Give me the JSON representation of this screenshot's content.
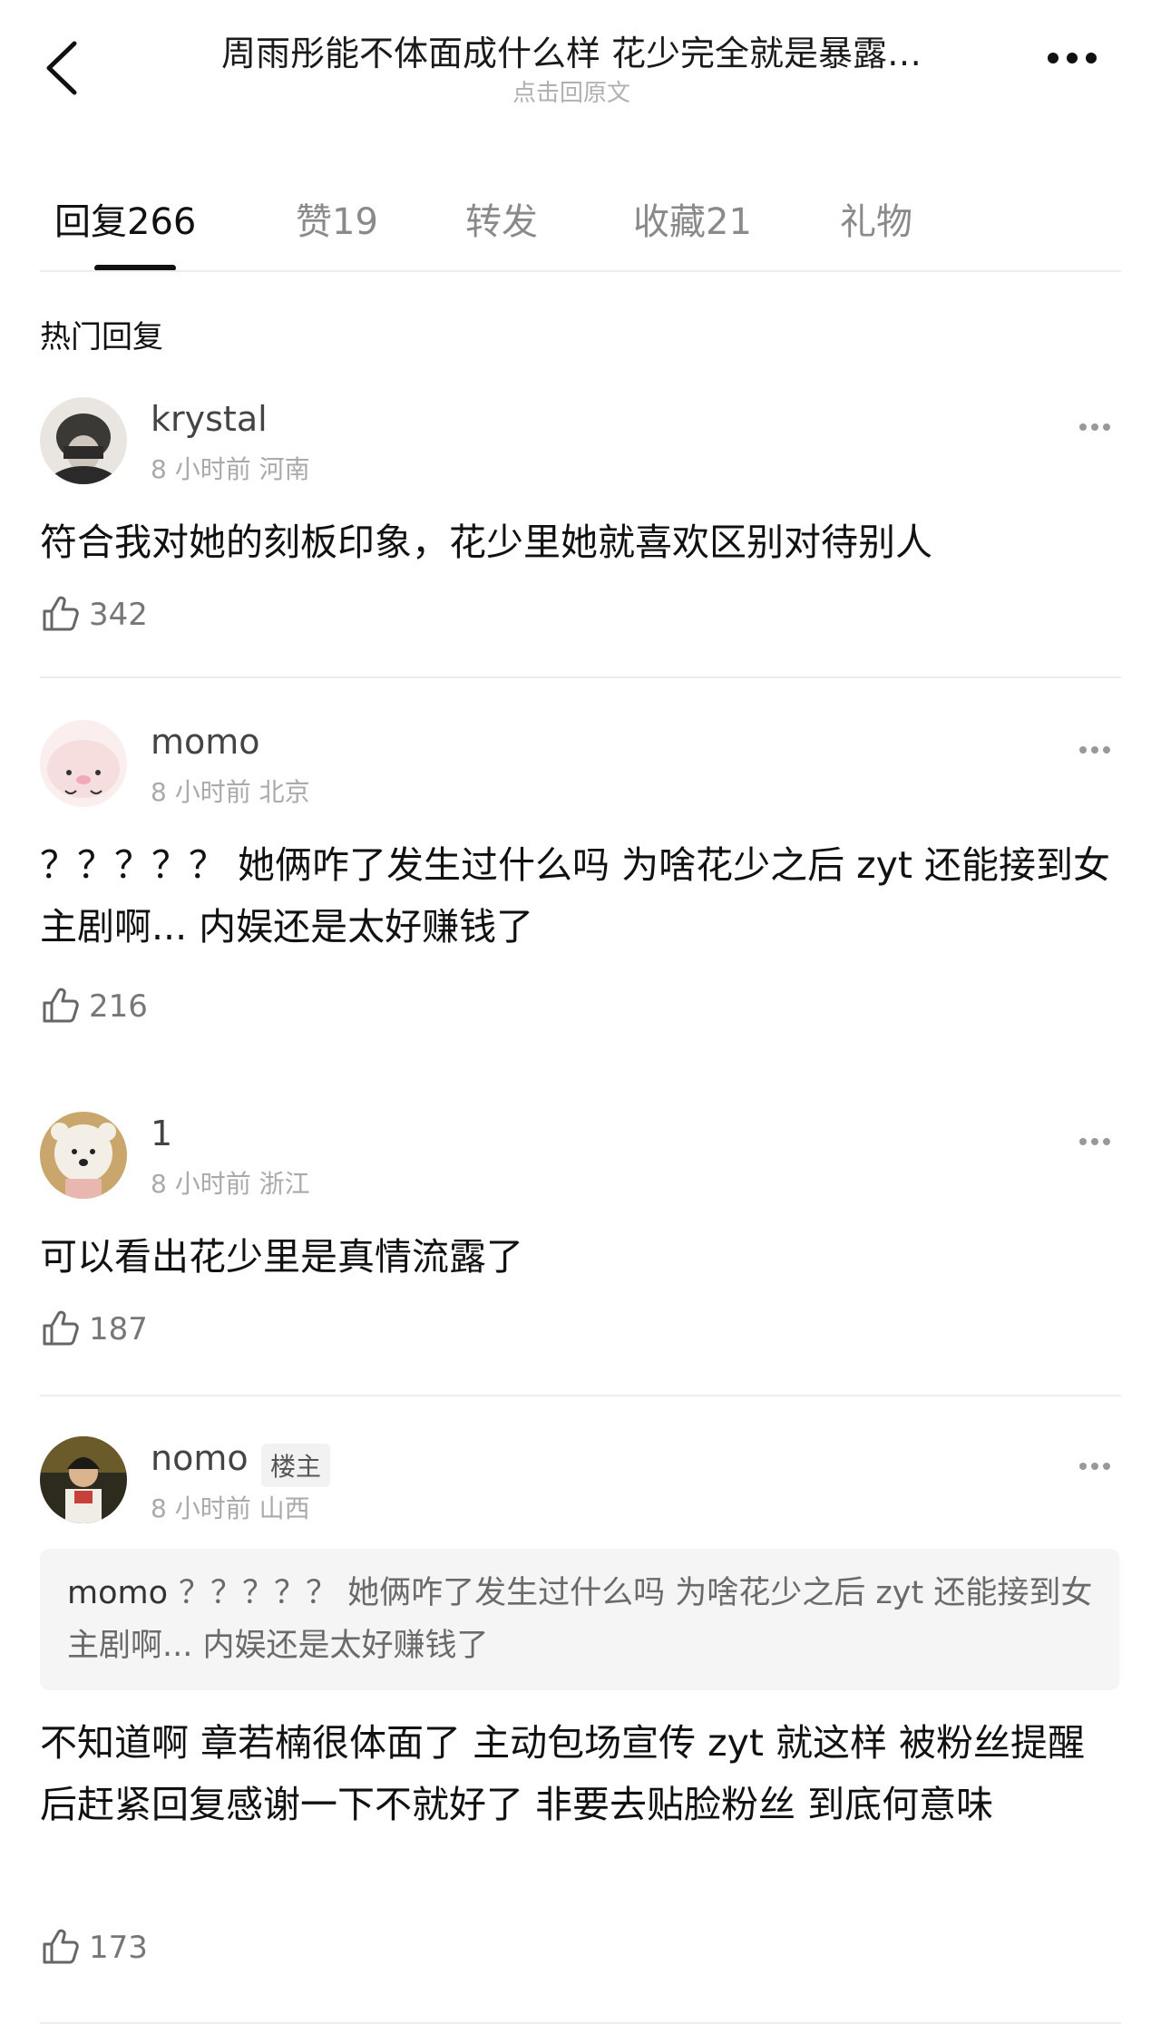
{
  "header": {
    "title": "周雨彤能不体面成什么样 花少完全就是暴露…",
    "subtitle": "点击回原文"
  },
  "tabs": [
    {
      "label": "回复266",
      "active": true
    },
    {
      "label": "赞19",
      "active": false
    },
    {
      "label": "转发",
      "active": false
    },
    {
      "label": "收藏21",
      "active": false
    },
    {
      "label": "礼物",
      "active": false
    }
  ],
  "section_title": "热门回复",
  "comments": [
    {
      "username": "krystal",
      "meta": "8 小时前 河南",
      "text": "符合我对她的刻板印象，花少里她就喜欢区别对待别人",
      "likes": "342"
    },
    {
      "username": "momo",
      "meta": "8 小时前 北京",
      "text": "？？？？？ 她俩咋了发生过什么吗 为啥花少之后 zyt 还能接到女主剧啊... 内娱还是太好赚钱了",
      "likes": "216"
    },
    {
      "username": "1",
      "meta": "8 小时前 浙江",
      "text": "可以看出花少里是真情流露了",
      "likes": "187"
    },
    {
      "username": "nomo",
      "badge": "楼主",
      "meta": "8 小时前 山西",
      "quote_user": "momo",
      "quote_text": "？？？？？ 她俩咋了发生过什么吗 为啥花少之后 zyt 还能接到女主剧啊... 内娱还是太好赚钱了",
      "text": "不知道啊 章若楠很体面了 主动包场宣传 zyt 就这样 被粉丝提醒后赶紧回复感谢一下不就好了 非要去贴脸粉丝 到底何意味",
      "likes": "173"
    }
  ]
}
